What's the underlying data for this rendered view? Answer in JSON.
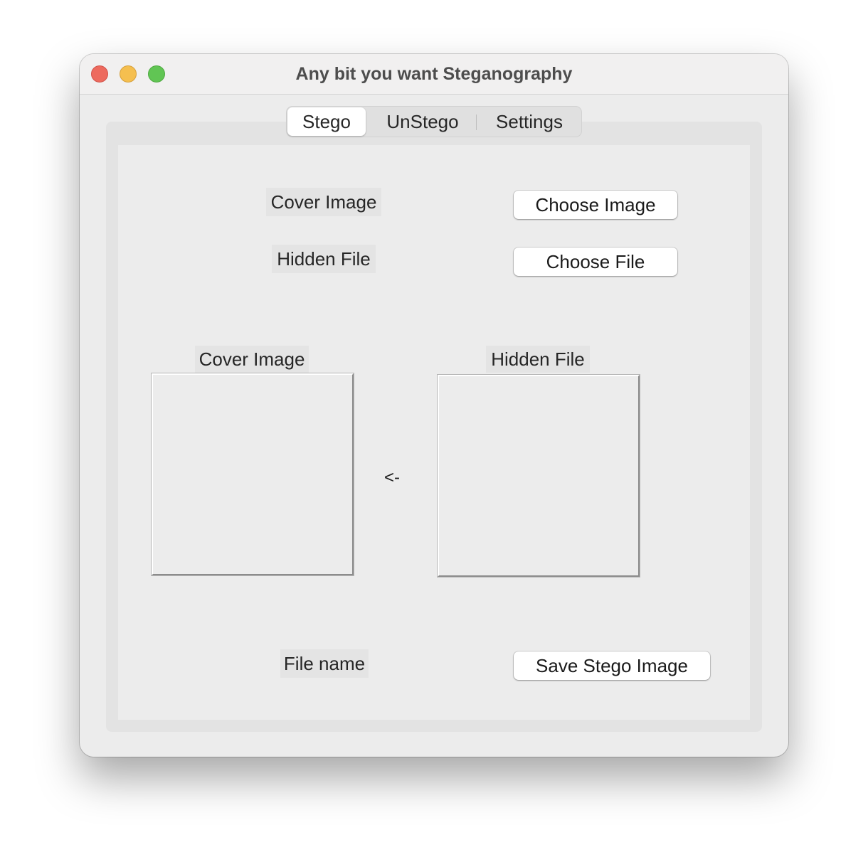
{
  "window": {
    "title": "Any bit you want Steganography"
  },
  "tabs": [
    {
      "label": "Stego",
      "selected": true
    },
    {
      "label": "UnStego",
      "selected": false
    },
    {
      "label": "Settings",
      "selected": false
    }
  ],
  "stego": {
    "cover_image_label": "Cover Image",
    "choose_image_button": "Choose Image",
    "hidden_file_label": "Hidden File",
    "choose_file_button": "Choose File",
    "cover_preview_title": "Cover Image",
    "hidden_preview_title": "Hidden File",
    "arrow_text": "<-",
    "file_name_label": "File name",
    "save_button": "Save Stego Image"
  },
  "colors": {
    "close": "#ed6a5e",
    "minimize": "#f5bf4f",
    "zoom": "#61c554"
  }
}
